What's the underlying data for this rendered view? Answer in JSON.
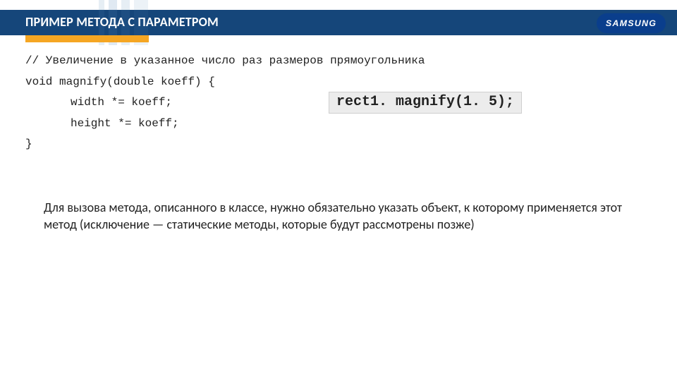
{
  "header": {
    "title": "ПРИМЕР МЕТОДА С ПАРАМЕТРОМ",
    "logo_text": "SAMSUNG"
  },
  "code": {
    "comment": "// Увеличение в указанное число раз размеров прямоугольника",
    "line1": "void magnify(double koeff) {",
    "line2": "width *= koeff;",
    "line3": "height *= koeff;",
    "line4": "}"
  },
  "call_example": "rect1. magnify(1. 5);",
  "body_paragraph": "Для вызова метода, описанного в классе, нужно обязательно указать объект, к которому применяется этот метод (исключение — статические методы, которые будут рассмотрены позже)"
}
